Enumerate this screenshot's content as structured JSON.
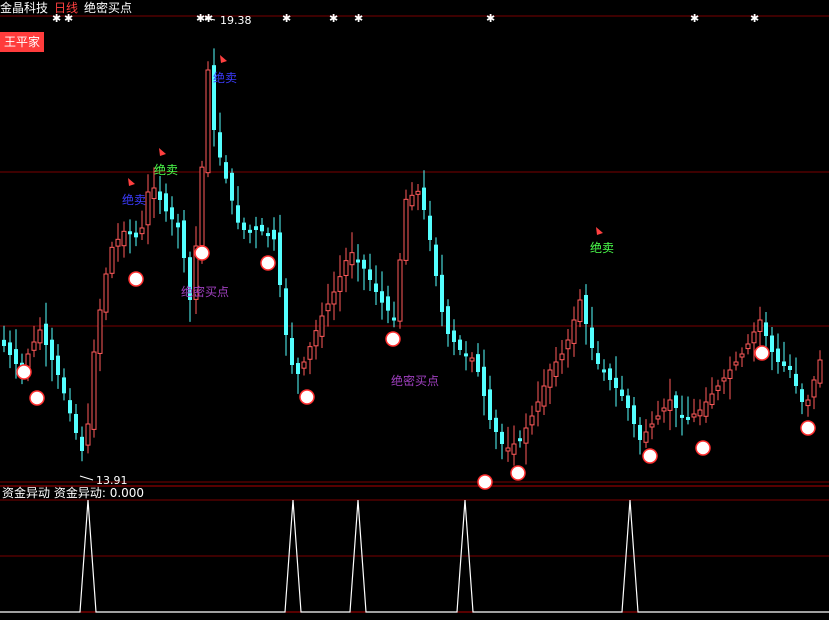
{
  "header": {
    "app_name": "金晶科技",
    "period": "日线",
    "indicator": "绝密买点"
  },
  "owner_badge": "王平家",
  "main_chart": {
    "high_label": "19.38",
    "low_label": "13.91",
    "sell_label": "绝卖",
    "buy_label": "绝密买点",
    "colors": {
      "up": "#ff5a5a",
      "down": "#54ffff",
      "grid": "#7a0000",
      "sell_green": "#4cff4c",
      "sell_blue": "#3c3cff",
      "buy_purple": "#a040c0"
    }
  },
  "sub_chart": {
    "title": "资金异动",
    "value_label": "资金异动: 0.000"
  }
}
